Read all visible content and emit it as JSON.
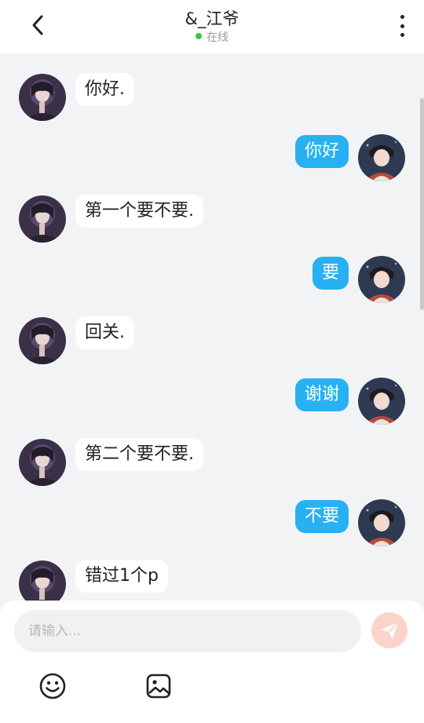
{
  "header": {
    "title": "&_江爷",
    "status": "在线",
    "back_icon": "chevron-left-icon",
    "more_icon": "more-vertical-icon"
  },
  "messages": [
    {
      "side": "left",
      "text": "你好."
    },
    {
      "side": "right",
      "text": "你好"
    },
    {
      "side": "left",
      "text": "第一个要不要."
    },
    {
      "side": "right",
      "text": "要"
    },
    {
      "side": "left",
      "text": "回关."
    },
    {
      "side": "right",
      "text": "谢谢"
    },
    {
      "side": "left",
      "text": "第二个要不要."
    },
    {
      "side": "right",
      "text": "不要"
    },
    {
      "side": "left",
      "text": "错过1个p"
    }
  ],
  "composer": {
    "placeholder": "请输入...",
    "value": "",
    "send_icon": "send-icon",
    "emoji_icon": "emoji-icon",
    "image_icon": "image-icon"
  },
  "colors": {
    "accent": "#27b1f2",
    "online": "#2ecc40",
    "send_disabled": "#fbd3cb",
    "background": "#f2f3f5"
  }
}
